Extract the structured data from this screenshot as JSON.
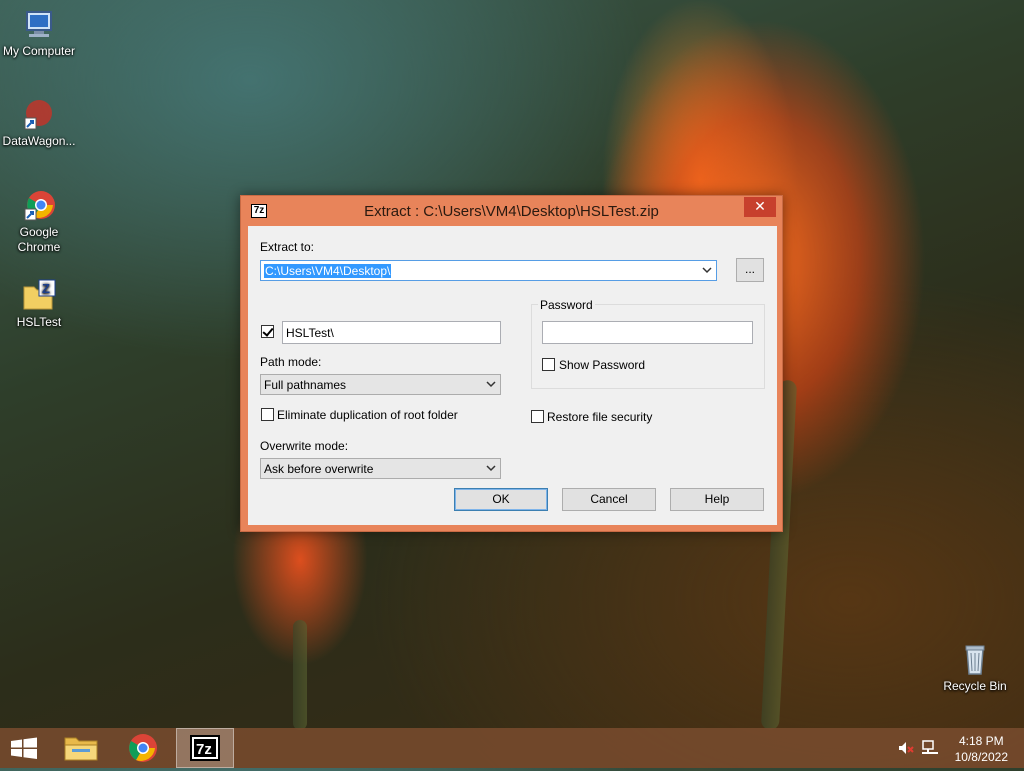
{
  "desktop": {
    "icons": [
      {
        "label": "My Computer"
      },
      {
        "label": "DataWagon..."
      },
      {
        "label": "Google Chrome"
      },
      {
        "label": "HSLTest"
      },
      {
        "label": "Recycle Bin"
      }
    ]
  },
  "dialog": {
    "title": "Extract : C:\\Users\\VM4\\Desktop\\HSLTest.zip",
    "app_icon": "7z",
    "close_label": "✕",
    "extract_to_label": "Extract to:",
    "extract_to_value": "C:\\Users\\VM4\\Desktop\\",
    "browse_label": "...",
    "subfolder_checked": true,
    "subfolder_value": "HSLTest\\",
    "path_mode_label": "Path mode:",
    "path_mode_value": "Full pathnames",
    "eliminate_dup_label": "Eliminate duplication of root folder",
    "eliminate_dup_checked": false,
    "overwrite_mode_label": "Overwrite mode:",
    "overwrite_mode_value": "Ask before overwrite",
    "password_group_label": "Password",
    "password_value": "",
    "show_password_label": "Show Password",
    "show_password_checked": false,
    "restore_security_label": "Restore file security",
    "restore_security_checked": false,
    "ok_label": "OK",
    "cancel_label": "Cancel",
    "help_label": "Help"
  },
  "taskbar": {
    "items": [
      "start-icon",
      "file-explorer-icon",
      "chrome-icon",
      "7zip-icon"
    ],
    "time": "4:18 PM",
    "date": "10/8/2022"
  },
  "colors": {
    "title_bar": "#e8845a",
    "close_button": "#c7402d",
    "selection": "#3399ff"
  }
}
